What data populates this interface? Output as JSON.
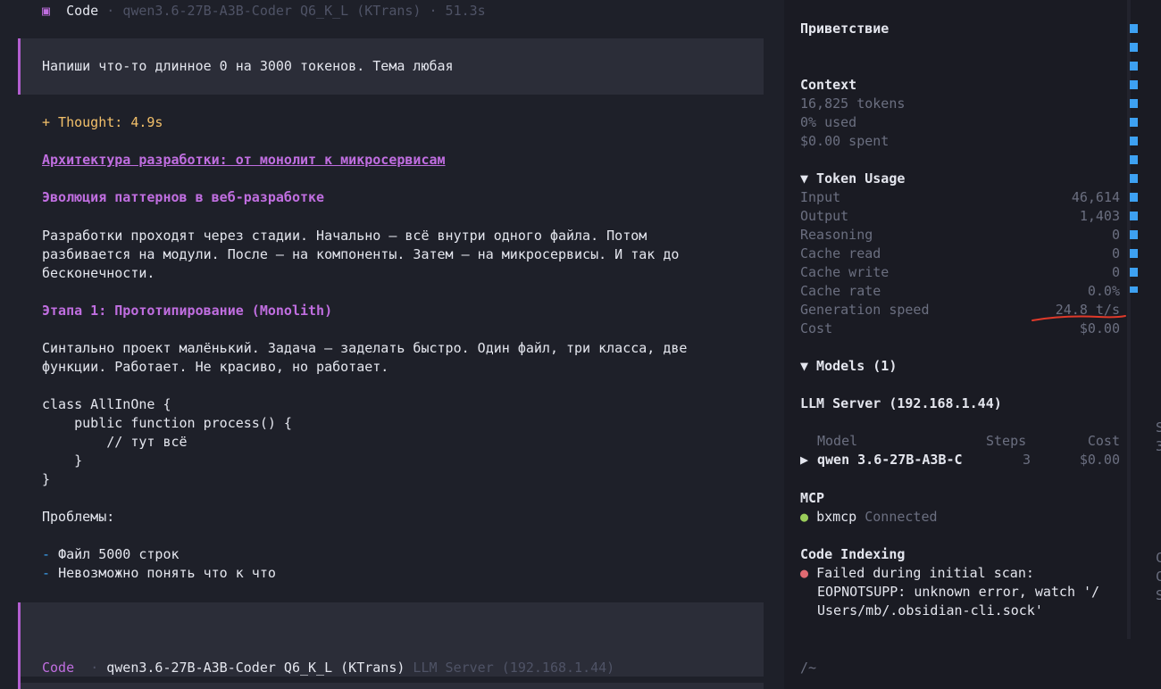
{
  "header": {
    "icon": "square-icon",
    "mode": "Code",
    "separator": "·",
    "model": "qwen3.6-27B-A3B-Coder Q6_K_L (KTrans)",
    "separator2": "·",
    "time": "51.3s"
  },
  "user_message": "Напиши что-то длинное 0 на 3000 токенов. Тема любая",
  "thought": "+ Thought: 4.9s",
  "content": {
    "h1": "Архитектура разработки: от монолит к микросервисам",
    "h2": "Эволюция паттернов в веб-разработке",
    "p1_line1": "Разработки проходят через стадии. Начально — всё внутри одного файла. Потом",
    "p1_line2": "разбивается на модули. После — на компоненты. Затем — на микросервисы. И так до",
    "p1_line3": "бесконечности.",
    "h3": "Этапа 1: Прототипирование (Monolith)",
    "p2_line1": "Синтально проект малёнький. Задача — заделать быстро. Один файл, три класса, две",
    "p2_line2": "функции. Работает. Не красиво, но работает.",
    "code1": "class AllInOne {",
    "code2": "    public function process() {",
    "code3": "        // тут всё",
    "code4": "    }",
    "code5": "}",
    "problems": "Проблемы:",
    "dash": "-",
    "item1": "Файл 5000 строк",
    "item2": "Невозможно понять что к что"
  },
  "input_footer": {
    "mode": "Code",
    "separator": "·",
    "model": "qwen3.6-27B-A3B-Coder Q6_K_L (KTrans)",
    "server": "LLM Server (192.168.1.44)"
  },
  "sidebar": {
    "title": "Приветствие",
    "context": {
      "heading": "Context",
      "tokens": "16,825 tokens",
      "used": "0% used",
      "spent": "$0.00 spent"
    },
    "token_usage": {
      "heading": "▼ Token Usage",
      "rows": [
        {
          "label": "Input",
          "value": "46,614"
        },
        {
          "label": "Output",
          "value": "1,403"
        },
        {
          "label": "Reasoning",
          "value": "0"
        },
        {
          "label": "Cache read",
          "value": "0"
        },
        {
          "label": "Cache write",
          "value": "0"
        },
        {
          "label": "Cache rate",
          "value": "0.0%"
        },
        {
          "label": "Generation speed",
          "value": "24.8 t/s"
        },
        {
          "label": "Cost",
          "value": "$0.00"
        }
      ]
    },
    "models": {
      "heading": "▼ Models (1)",
      "server": "LLM Server (192.168.1.44)",
      "col_model": "Model",
      "col_steps": "Steps",
      "col_cost": "Cost",
      "row_arrow": "▶",
      "row_model": "qwen 3.6-27B-A3B-C",
      "row_steps": "3",
      "row_cost": "$0.00"
    },
    "mcp": {
      "heading": "MCP",
      "bullet": "●",
      "name": "bxmcp",
      "status": "Connected"
    },
    "code_indexing": {
      "heading": "Code Indexing",
      "bullet": "●",
      "line1": "Failed during initial scan:",
      "line2": "EOPNOTSUPP: unknown error, watch '/",
      "line3": "Users/mb/.obsidian-cli.sock'"
    },
    "path": "/~",
    "edge_chars": {
      "c1": "S",
      "c2": "3",
      "c3": "C",
      "c4": "C",
      "c5": "S"
    }
  },
  "colors": {
    "background": "#1e2029",
    "sidebar_bg": "#1a1b23",
    "accent_purple": "#c06ee0",
    "accent_bar": "#b25ecf",
    "thought_orange": "#f3c06a",
    "scroll_blue": "#3da1f2",
    "annotation_red": "#e03a2a"
  }
}
